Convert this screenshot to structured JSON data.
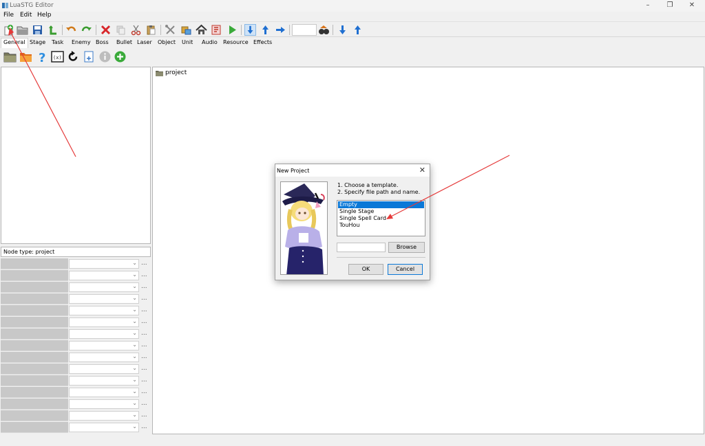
{
  "window": {
    "title": "LuaSTG Editor"
  },
  "menu": [
    "File",
    "Edit",
    "Help"
  ],
  "tabs": [
    "General",
    "Stage",
    "Task",
    "Enemy",
    "Boss",
    "Bullet",
    "Laser",
    "Object",
    "Unit",
    "Audio",
    "Resource",
    "Effects"
  ],
  "toolbar": {
    "icons": [
      "new-project-icon",
      "open-folder-icon",
      "save-icon",
      "export-icon",
      "undo-icon",
      "redo-icon",
      "delete-icon",
      "copy-disabled-icon",
      "cut-icon",
      "paste-icon",
      "tools-icon",
      "pack-icon",
      "home-icon",
      "build-icon",
      "run-icon",
      "insert-child-icon",
      "insert-before-icon",
      "insert-after-icon",
      "debug-run-icon",
      "move-down-icon",
      "move-up-icon"
    ]
  },
  "toolbar2": {
    "icons": [
      "folder-icon",
      "folder-orange-icon",
      "help-icon",
      "code-icon",
      "refresh-icon",
      "document-icon",
      "info-icon",
      "add-icon"
    ]
  },
  "tree": {
    "root_label": "project"
  },
  "properties": {
    "node_type_label": "Node type: project",
    "row_count": 15,
    "more_label": "..."
  },
  "dialog": {
    "title": "New Project",
    "close_glyph": "✕",
    "instructions": [
      "1. Choose a template.",
      "2. Specify file path and name."
    ],
    "templates": [
      "Empty",
      "Single Stage",
      "Single Spell Card",
      "TouHou"
    ],
    "selected_template": "Empty",
    "path_value": "",
    "browse_label": "Browse",
    "ok_label": "OK",
    "cancel_label": "Cancel"
  },
  "colors": {
    "selection": "#0a78d7",
    "annotation_arrow": "#e53a3a"
  }
}
